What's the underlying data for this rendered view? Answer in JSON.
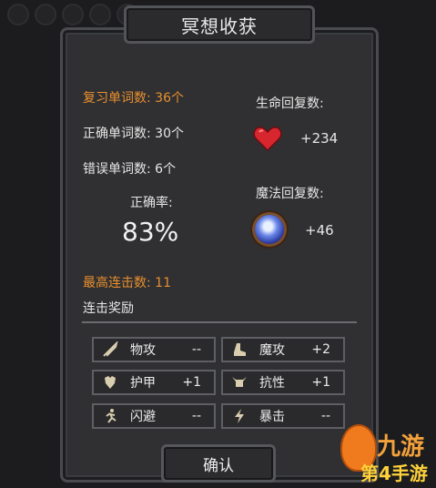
{
  "title": "冥想收获",
  "review_words": "复习单词数: 36个",
  "correct_words": "正确单词数: 30个",
  "wrong_words": "错误单词数: 6个",
  "accuracy_label": "正确率:",
  "accuracy_value": "83%",
  "hp_label": "生命回复数:",
  "hp_value": "+234",
  "mp_label": "魔法回复数:",
  "mp_value": "+46",
  "max_combo": "最高连击数: 11",
  "combo_reward_label": "连击奖励",
  "stats": [
    {
      "name": "物攻",
      "value": "--",
      "icon": "sword-icon"
    },
    {
      "name": "魔攻",
      "value": "+2",
      "icon": "boot-icon"
    },
    {
      "name": "护甲",
      "value": "+1",
      "icon": "armor-icon"
    },
    {
      "name": "抗性",
      "value": "+1",
      "icon": "horned-helmet-icon"
    },
    {
      "name": "闪避",
      "value": "--",
      "icon": "running-figure-icon"
    },
    {
      "name": "暴击",
      "value": "--",
      "icon": "lightning-icon"
    }
  ],
  "confirm_label": "确认",
  "watermark": {
    "line1": "九游",
    "line2": "第4手游"
  },
  "colors": {
    "accent": "#e98f2e",
    "panel": "#303032",
    "heart": "#d8262e",
    "orb": "#6a86e8"
  }
}
